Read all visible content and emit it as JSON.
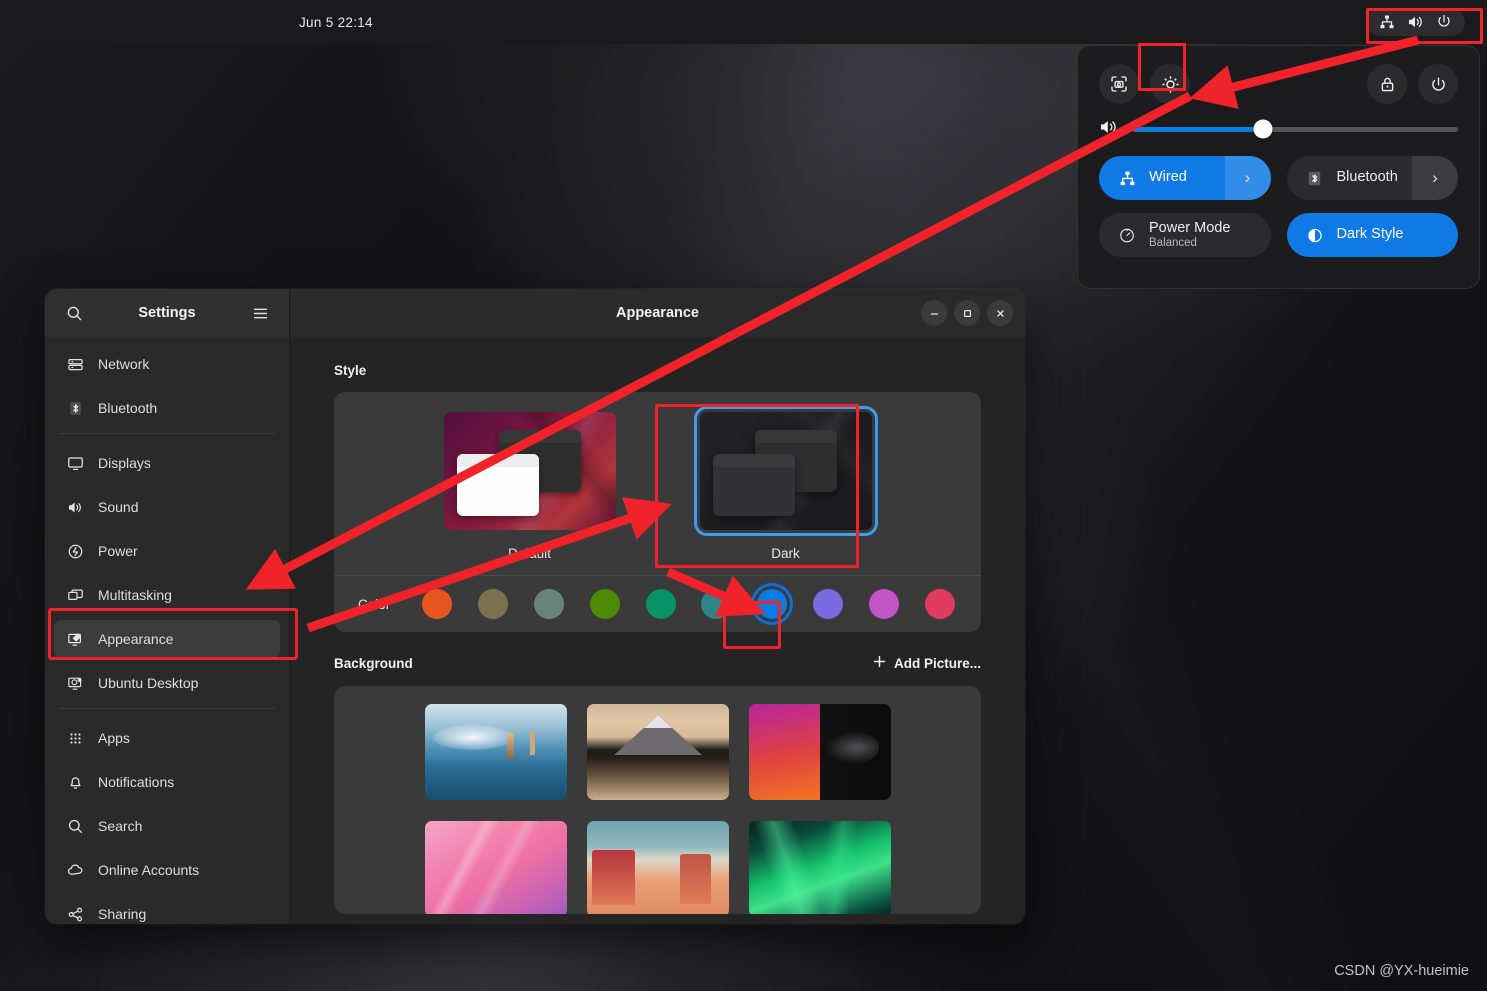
{
  "topbar": {
    "clock": "Jun 5  22:14",
    "indicators": [
      {
        "name": "network-wired-icon",
        "label": "Wired network"
      },
      {
        "name": "volume-icon",
        "label": "Volume"
      },
      {
        "name": "power-icon",
        "label": "System"
      }
    ]
  },
  "quick_settings": {
    "buttons": [
      {
        "name": "screenshot-button",
        "label": "Take Screenshot"
      },
      {
        "name": "settings-gear-button",
        "label": "Settings"
      },
      {
        "name": "lock-button",
        "label": "Lock Screen"
      },
      {
        "name": "power-off-button",
        "label": "Power Off / Log Out"
      }
    ],
    "volume": {
      "label": "Volume",
      "value": 40
    },
    "tiles": [
      {
        "name": "wired-tile",
        "title": "Wired",
        "subtitle": "",
        "active": true,
        "has_arrow": true,
        "icon": "network-wired-icon"
      },
      {
        "name": "bluetooth-tile",
        "title": "Bluetooth",
        "subtitle": "",
        "active": false,
        "has_arrow": true,
        "icon": "bluetooth-icon"
      },
      {
        "name": "power-mode-tile",
        "title": "Power Mode",
        "subtitle": "Balanced",
        "active": false,
        "has_arrow": false,
        "icon": "gauge-icon"
      },
      {
        "name": "dark-style-tile",
        "title": "Dark Style",
        "subtitle": "",
        "active": true,
        "has_arrow": false,
        "icon": "half-circle-icon"
      }
    ]
  },
  "settings": {
    "sidebar": {
      "title": "Settings",
      "search_label": "Search",
      "menu_label": "Main Menu",
      "groups": [
        {
          "items": [
            {
              "label": "Network",
              "icon": "network-icon",
              "selected": false
            },
            {
              "label": "Bluetooth",
              "icon": "bluetooth-icon",
              "selected": false
            }
          ]
        },
        {
          "items": [
            {
              "label": "Displays",
              "icon": "display-icon",
              "selected": false
            },
            {
              "label": "Sound",
              "icon": "sound-icon",
              "selected": false
            },
            {
              "label": "Power",
              "icon": "power-bolt-icon",
              "selected": false
            },
            {
              "label": "Multitasking",
              "icon": "multitasking-icon",
              "selected": false
            },
            {
              "label": "Appearance",
              "icon": "appearance-icon",
              "selected": true
            },
            {
              "label": "Ubuntu Desktop",
              "icon": "ubuntu-desktop-icon",
              "selected": false
            }
          ]
        },
        {
          "items": [
            {
              "label": "Apps",
              "icon": "apps-grid-icon",
              "selected": false
            },
            {
              "label": "Notifications",
              "icon": "bell-icon",
              "selected": false
            },
            {
              "label": "Search",
              "icon": "search-icon",
              "selected": false
            },
            {
              "label": "Online Accounts",
              "icon": "cloud-icon",
              "selected": false
            },
            {
              "label": "Sharing",
              "icon": "share-icon",
              "selected": false
            }
          ]
        }
      ]
    },
    "window": {
      "title": "Appearance",
      "controls": [
        {
          "name": "minimize-button",
          "glyph": "—"
        },
        {
          "name": "maximize-button",
          "glyph": "□"
        },
        {
          "name": "close-button",
          "glyph": "×"
        }
      ]
    },
    "style_section": {
      "heading": "Style",
      "options": [
        {
          "label": "Default",
          "selected": false
        },
        {
          "label": "Dark",
          "selected": true
        }
      ],
      "color_label": "Color",
      "swatches": [
        {
          "name": "orange",
          "hex": "#e9551f",
          "selected": false
        },
        {
          "name": "olive",
          "hex": "#7d7150",
          "selected": false
        },
        {
          "name": "sage",
          "hex": "#68847a",
          "selected": false
        },
        {
          "name": "green",
          "hex": "#4d8b06",
          "selected": false
        },
        {
          "name": "emerald",
          "hex": "#079366",
          "selected": false
        },
        {
          "name": "teal",
          "hex": "#2d8589",
          "selected": false
        },
        {
          "name": "blue",
          "hex": "#0a7ae4",
          "selected": true
        },
        {
          "name": "purple",
          "hex": "#7a6ae0",
          "selected": false
        },
        {
          "name": "magenta",
          "hex": "#c153c4",
          "selected": false
        },
        {
          "name": "pink",
          "hex": "#e03a5e",
          "selected": false
        }
      ]
    },
    "background_section": {
      "heading": "Background",
      "add_picture_label": "Add Picture...",
      "wallpapers": [
        {
          "name": "wallpaper-lake-reflection"
        },
        {
          "name": "wallpaper-mount-fuji"
        },
        {
          "name": "wallpaper-ubuntu-mascot"
        },
        {
          "name": "wallpaper-pink-rays"
        },
        {
          "name": "wallpaper-canyon"
        },
        {
          "name": "wallpaper-aurora"
        }
      ]
    }
  },
  "watermark": "CSDN @YX-hueimie",
  "colors": {
    "accent_blue": "#0f7ae5",
    "annotation_red": "#f0232b",
    "selection_ring": "#3c9cf0"
  }
}
